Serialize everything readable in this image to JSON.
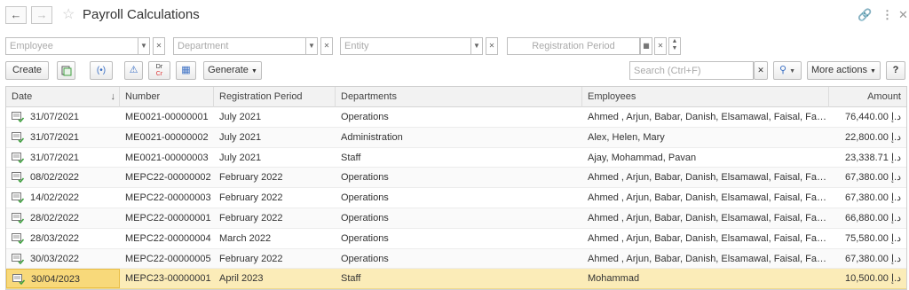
{
  "titlebar": {
    "back_icon": "arrow-left-icon",
    "forward_icon": "arrow-right-icon",
    "favorite_icon": "star-icon",
    "title": "Payroll Calculations",
    "link_icon": "link-icon",
    "menu_icon": "more-vertical-icon",
    "close_icon": "close-icon"
  },
  "filters": {
    "employee_placeholder": "Employee",
    "department_placeholder": "Department",
    "entity_placeholder": "Entity",
    "period_placeholder": "Registration Period"
  },
  "toolbar": {
    "create_label": "Create",
    "generate_label": "Generate",
    "search_placeholder": "Search (Ctrl+F)",
    "more_actions_label": "More actions",
    "help_label": "?",
    "dr_label": "Dr",
    "cr_label": "Cr"
  },
  "table": {
    "columns": [
      "Date",
      "Number",
      "Registration Period",
      "Departments",
      "Employees",
      "Amount"
    ],
    "rows": [
      {
        "date": "31/07/2021",
        "number": "ME0021-00000001",
        "period": "July 2021",
        "departments": "Operations",
        "employees": "Ahmed , Arjun, Babar, Danish, Elsamawal, Faisal, Farh...",
        "amount": "76,440.00 د.إ"
      },
      {
        "date": "31/07/2021",
        "number": "ME0021-00000002",
        "period": "July 2021",
        "departments": "Administration",
        "employees": "Alex, Helen, Mary",
        "amount": "22,800.00 د.إ"
      },
      {
        "date": "31/07/2021",
        "number": "ME0021-00000003",
        "period": "July 2021",
        "departments": "Staff",
        "employees": "Ajay, Mohammad, Pavan",
        "amount": "23,338.71 د.إ"
      },
      {
        "date": "08/02/2022",
        "number": "MEPC22-00000002",
        "period": "February 2022",
        "departments": "Operations",
        "employees": "Ahmed , Arjun, Babar, Danish, Elsamawal, Faisal, Farh...",
        "amount": "67,380.00 د.إ"
      },
      {
        "date": "14/02/2022",
        "number": "MEPC22-00000003",
        "period": "February 2022",
        "departments": "Operations",
        "employees": "Ahmed , Arjun, Babar, Danish, Elsamawal, Faisal, Farh...",
        "amount": "67,380.00 د.إ"
      },
      {
        "date": "28/02/2022",
        "number": "MEPC22-00000001",
        "period": "February 2022",
        "departments": "Operations",
        "employees": "Ahmed , Arjun, Babar, Danish, Elsamawal, Faisal, Farh...",
        "amount": "66,880.00 د.إ"
      },
      {
        "date": "28/03/2022",
        "number": "MEPC22-00000004",
        "period": "March 2022",
        "departments": "Operations",
        "employees": "Ahmed , Arjun, Babar, Danish, Elsamawal, Faisal, Farh...",
        "amount": "75,580.00 د.إ"
      },
      {
        "date": "30/03/2022",
        "number": "MEPC22-00000005",
        "period": "February 2022",
        "departments": "Operations",
        "employees": "Ahmed , Arjun, Babar, Danish, Elsamawal, Faisal, Farh...",
        "amount": "67,380.00 د.إ"
      },
      {
        "date": "30/04/2023",
        "number": "MEPC23-00000001",
        "period": "April 2023",
        "departments": "Staff",
        "employees": "Mohammad",
        "amount": "10,500.00 د.إ"
      }
    ],
    "selected_row": 8,
    "sort_column": "Date"
  },
  "colors": {
    "selected_row": "#fbecb8",
    "selected_cell": "#f8d97a",
    "header_bg": "#f2f2f2",
    "accent_blue": "#3a6fc4",
    "doc_icon_green": "#3f9f3f"
  }
}
